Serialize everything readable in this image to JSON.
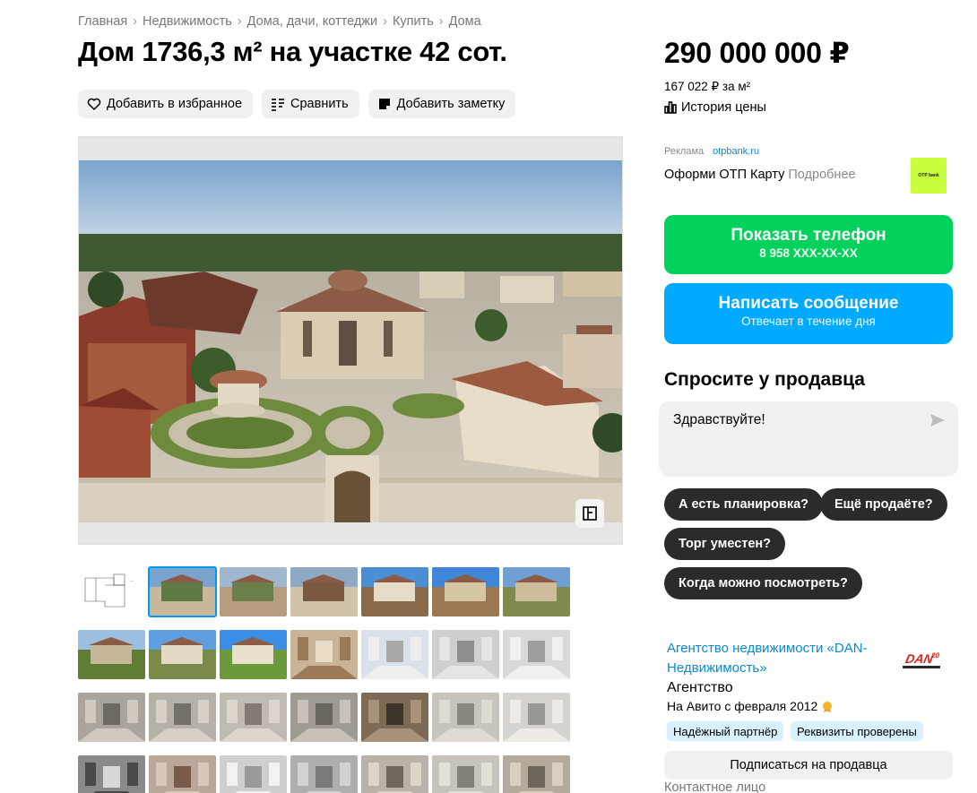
{
  "breadcrumbs": [
    "Главная",
    "Недвижимость",
    "Дома, дачи, коттеджи",
    "Купить",
    "Дома"
  ],
  "breadcrumb_separator": "›",
  "title": "Дом 1736,3 м² на участке 42 сот.",
  "actions": {
    "favorite": "Добавить в избранное",
    "compare": "Сравнить",
    "note": "Добавить заметку"
  },
  "price": {
    "value": "290 000 000 ₽",
    "per_m2": "167 022 ₽ за м²",
    "history": "История цены"
  },
  "ad": {
    "label": "Реклама",
    "domain": "otpbank.ru",
    "text": "Оформи ОТП Карту",
    "more": "Подробнее",
    "logo_text": "OTP bank"
  },
  "contact_buttons": {
    "phone_label": "Показать телефон",
    "phone_number": "8 958 XXX-XX-XX",
    "message_label": "Написать сообщение",
    "message_sub": "Отвечает в течение дня"
  },
  "ask": {
    "title": "Спросите у продавца",
    "input_value": "Здравствуйте!",
    "chips": [
      "А есть планировка?",
      "Ещё продаёте?",
      "Торг уместен?",
      "Когда можно посмотреть?"
    ]
  },
  "seller": {
    "name": "Агентство недвижимости «DAN-Недвижимость»",
    "type": "Агентство",
    "since": "На Авито с февраля 2012",
    "logo_text": "DAN",
    "logo_sup": "20",
    "badges": [
      "Надёжный партнёр",
      "Реквизиты проверены"
    ],
    "subscribe": "Подписаться на продавца",
    "contact_label": "Контактное лицо"
  },
  "gallery": {
    "active_index": 1,
    "thumbnails": [
      "floor-plan",
      "aerial-estate",
      "aerial-village",
      "aerial-estate-close",
      "facade-front",
      "facade-dome",
      "courtyard",
      "house-garden",
      "gazebo-close",
      "gazebo-lawn",
      "interior-dome-ceiling",
      "interior-windows",
      "interior-hall",
      "interior-arches",
      "interior-raw-1",
      "interior-raw-2",
      "interior-raw-3",
      "interior-staircase",
      "interior-doorway",
      "interior-columns",
      "interior-bright",
      "interior-window-arch",
      "interior-room-red",
      "interior-window-tall",
      "interior-hall-2",
      "interior-chandelier",
      "interior-corridor",
      "interior-round-window"
    ]
  },
  "colors": {
    "green": "#02d15c",
    "blue": "#00aaff",
    "link": "#0a8ad1",
    "chip": "#2b2b2b"
  }
}
